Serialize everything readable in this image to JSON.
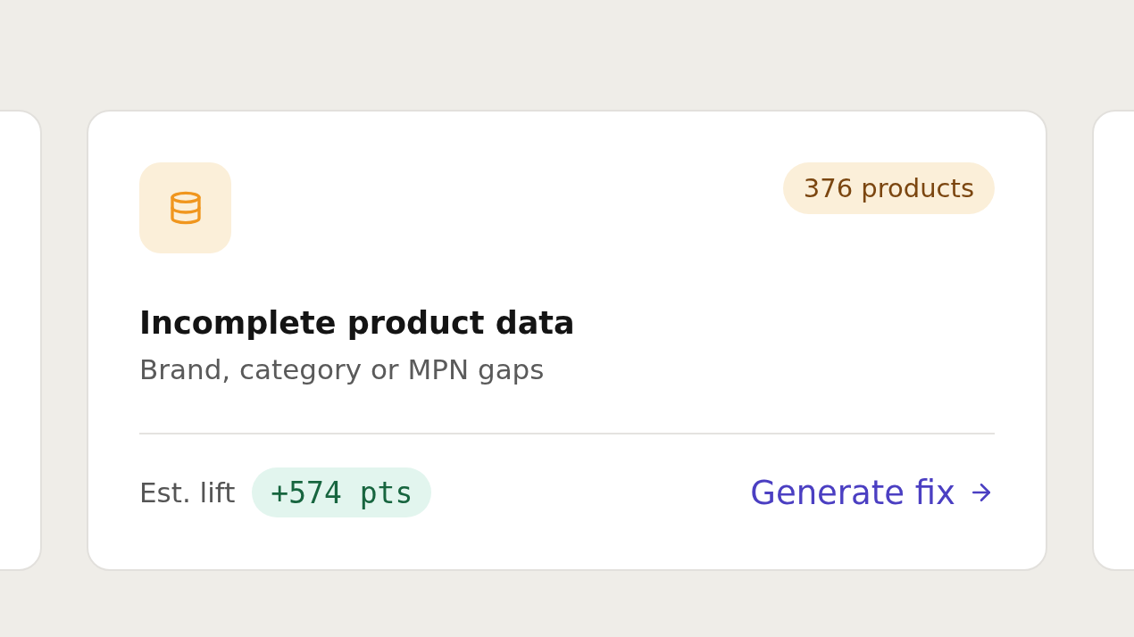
{
  "card": {
    "count_badge": "376 products",
    "title": "Incomplete product data",
    "subtitle": "Brand, category or MPN gaps",
    "footer": {
      "lift_label": "Est. lift",
      "lift_value": "+574 pts",
      "action": "Generate fix"
    }
  }
}
